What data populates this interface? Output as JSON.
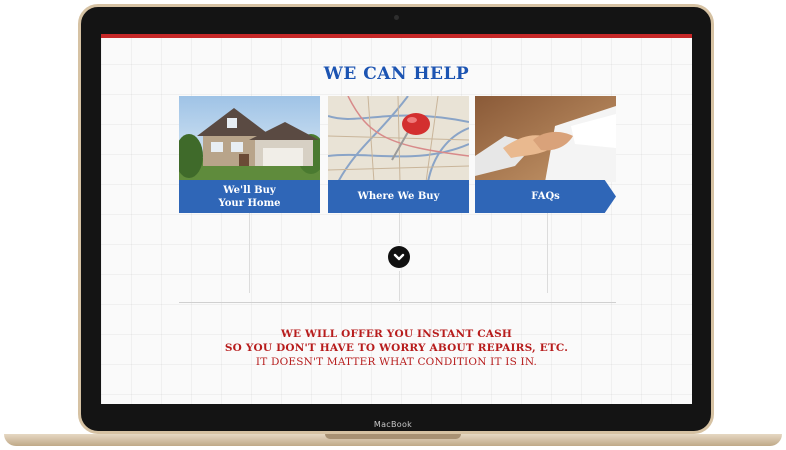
{
  "device": {
    "brand_label": "MacBook"
  },
  "page": {
    "heading": "WE CAN HELP",
    "cards": [
      {
        "label": "We'll Buy\nYour Home",
        "image": "house-photo"
      },
      {
        "label": "Where We Buy",
        "image": "map-pin-photo"
      },
      {
        "label": "FAQs",
        "image": "handshake-photo"
      }
    ],
    "scroll_icon": "chevron-down-icon",
    "message": {
      "line1": "WE WILL OFFER YOU INSTANT CASH",
      "line2": "SO YOU DON'T HAVE TO WORRY ABOUT REPAIRS, ETC.",
      "line3": "IT DOESN'T MATTER WHAT CONDITION IT IS IN."
    }
  },
  "colors": {
    "accent_red": "#c62828",
    "heading_blue": "#1c54b2",
    "card_label_blue": "#2f66b7",
    "laptop_bezel": "#141414",
    "laptop_body": "#d6c2a3"
  }
}
